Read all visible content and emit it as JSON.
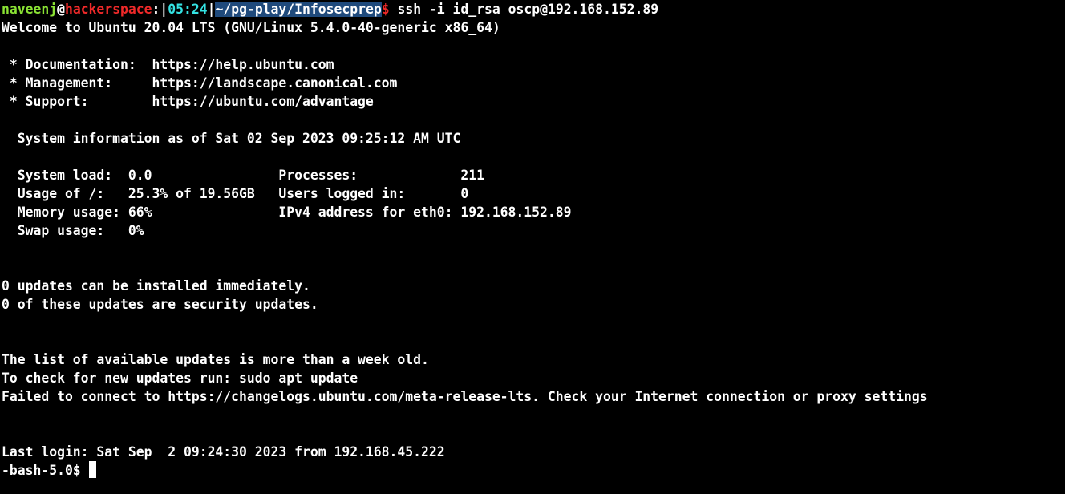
{
  "prompt": {
    "user": "naveenj",
    "at": "@",
    "host": "hackerspace",
    "sep1": ":|",
    "time": "05:24",
    "sep2": "|",
    "path": "~/pg-play/Infosecprep",
    "dollar": "$",
    "command": " ssh -i id_rsa oscp@192.168.152.89"
  },
  "output_lines": [
    "Welcome to Ubuntu 20.04 LTS (GNU/Linux 5.4.0-40-generic x86_64)",
    "",
    " * Documentation:  https://help.ubuntu.com",
    " * Management:     https://landscape.canonical.com",
    " * Support:        https://ubuntu.com/advantage",
    "",
    "  System information as of Sat 02 Sep 2023 09:25:12 AM UTC",
    "",
    "  System load:  0.0                Processes:             211",
    "  Usage of /:   25.3% of 19.56GB   Users logged in:       0",
    "  Memory usage: 66%                IPv4 address for eth0: 192.168.152.89",
    "  Swap usage:   0%",
    "",
    "",
    "0 updates can be installed immediately.",
    "0 of these updates are security updates.",
    "",
    "",
    "The list of available updates is more than a week old.",
    "To check for new updates run: sudo apt update",
    "Failed to connect to https://changelogs.ubuntu.com/meta-release-lts. Check your Internet connection or proxy settings",
    "",
    "",
    "Last login: Sat Sep  2 09:24:30 2023 from 192.168.45.222"
  ],
  "remote_prompt": "-bash-5.0$ "
}
